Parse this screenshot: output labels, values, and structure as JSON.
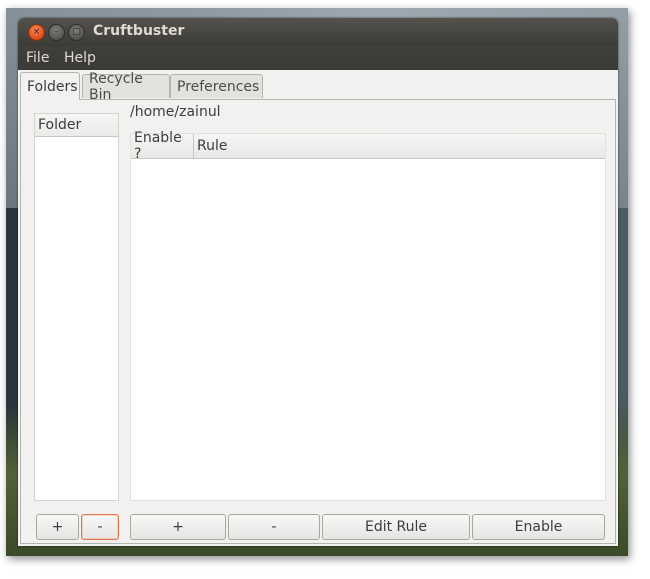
{
  "window": {
    "title": "Cruftbuster",
    "controls": {
      "close_glyph": "×",
      "minimize_glyph": "–",
      "maximize_glyph": "□"
    }
  },
  "menubar": {
    "items": [
      {
        "label": "File"
      },
      {
        "label": "Help"
      }
    ]
  },
  "tabs": [
    {
      "label": "Folders",
      "active": true
    },
    {
      "label": "Recycle Bin",
      "active": false
    },
    {
      "label": "Preferences",
      "active": false
    }
  ],
  "folders": {
    "header": "Folder",
    "items": [],
    "add_label": "+",
    "remove_label": "-"
  },
  "rules": {
    "current_path": "/home/zainul",
    "columns": [
      {
        "label": "Enable ?"
      },
      {
        "label": "Rule"
      }
    ],
    "rows": [],
    "buttons": {
      "add": "+",
      "remove": "-",
      "edit": "Edit Rule",
      "enable": "Enable"
    }
  },
  "colors": {
    "titlebar": "#3c3b37",
    "close_button": "#df4a16",
    "focus_border": "#e07a4d",
    "window_bg": "#f2f1f0"
  }
}
